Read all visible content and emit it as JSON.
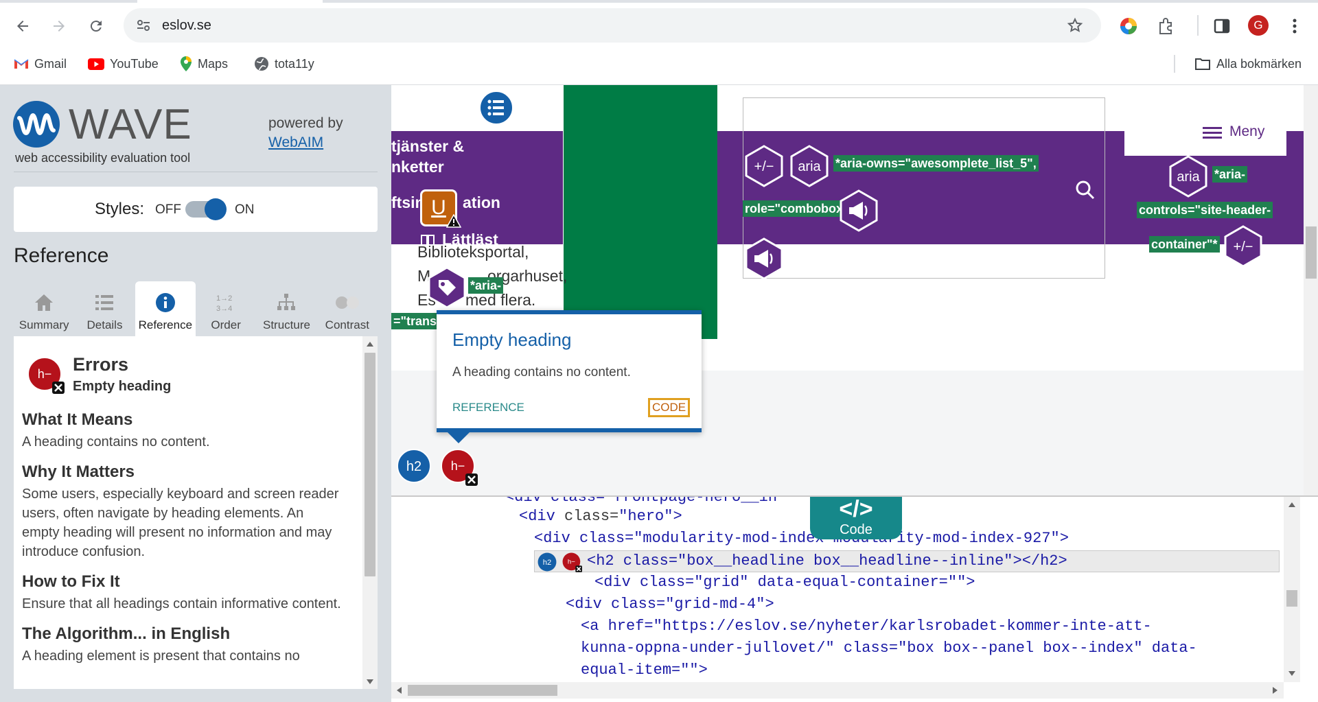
{
  "browser": {
    "url": "eslov.se",
    "bookmarks": [
      {
        "label": "Gmail",
        "icon": "gmail-icon"
      },
      {
        "label": "YouTube",
        "icon": "youtube-icon"
      },
      {
        "label": "Maps",
        "icon": "maps-icon"
      },
      {
        "label": "tota11y",
        "icon": "globe-icon"
      }
    ],
    "all_bookmarks": "Alla bokmärken",
    "profile_initial": "G",
    "colors": {
      "profile": "#c5221f"
    }
  },
  "wave": {
    "logo": "WAVE",
    "tagline": "web accessibility evaluation tool",
    "powered_by": "powered by",
    "webaim": "WebAIM",
    "styles_label": "Styles:",
    "off": "OFF",
    "on": "ON",
    "section_title": "Reference",
    "tabs": [
      "Summary",
      "Details",
      "Reference",
      "Order",
      "Structure",
      "Contrast"
    ],
    "active_tab": "Reference",
    "reference": {
      "category": "Errors",
      "item": "Empty heading",
      "what_title": "What It Means",
      "what_text": "A heading contains no content.",
      "why_title": "Why It Matters",
      "why_text": "Some users, especially keyboard and screen reader users, often navigate by heading elements. An empty heading will present no information and may introduce confusion.",
      "how_title": "How to Fix It",
      "how_text": "Ensure that all headings contain informative content.",
      "algo_title": "The Algorithm... in English",
      "algo_text": "A heading element is present that contains no"
    },
    "colors": {
      "error": "#b5121b",
      "accent": "#1560a8"
    }
  },
  "site": {
    "nav_text_1": "tjänster &",
    "nav_text_2": "nketter",
    "nav_text_3": "ftsin",
    "nav_text_3b": "ation",
    "lattlast": "Lättläst",
    "body_1": "Biblioteksportal,",
    "body_2": "M",
    "body_2b": "orgarhuset,",
    "body_3": "Es",
    "body_3b": "med flera.",
    "aria_short": "*aria-",
    "transl": "=\"transl",
    "aria_owns": "*aria-owns=\"awesomplete_list_5\",",
    "role_combobox": "role=\"combobox\"*",
    "menu": "Meny",
    "aria": "aria",
    "aria_controls_1": "*aria-",
    "aria_controls_2": "controls=\"site-header-",
    "aria_controls_3": "container\"*",
    "plusminus": "+/−",
    "h2_badge": "h2",
    "hminus_badge": "h−",
    "u_badge": "U",
    "colors": {
      "purple": "#5e2a84",
      "green": "#007c45",
      "label_green": "#208050"
    }
  },
  "popup": {
    "title": "Empty heading",
    "text": "A heading contains no content.",
    "reference": "REFERENCE",
    "code": "CODE"
  },
  "code": {
    "toggle_label": "Code",
    "toggle_symbol": "</>",
    "line0": "<div class=\"frontpage-hero__in",
    "line1_tag": "<div ",
    "line1_attr": "class=",
    "line1_val": "\"hero\"",
    "line1_end": ">",
    "line2": "<div class=\"modularity-mod-index modularity-mod-index-927\">",
    "line3": "<h2 class=\"box__headline box__headline--inline\"></h2>",
    "line4": "<div class=\"grid\" data-equal-container=\"\">",
    "line5": "<div class=\"grid-md-4\">",
    "line6": "<a href=\"https://eslov.se/nyheter/karlsrobadet-kommer-inte-att-",
    "line7": "kunna-oppna-under-jullovet/\" class=\"box box--panel box--index\" data-",
    "line8": "equal-item=\"\">"
  }
}
